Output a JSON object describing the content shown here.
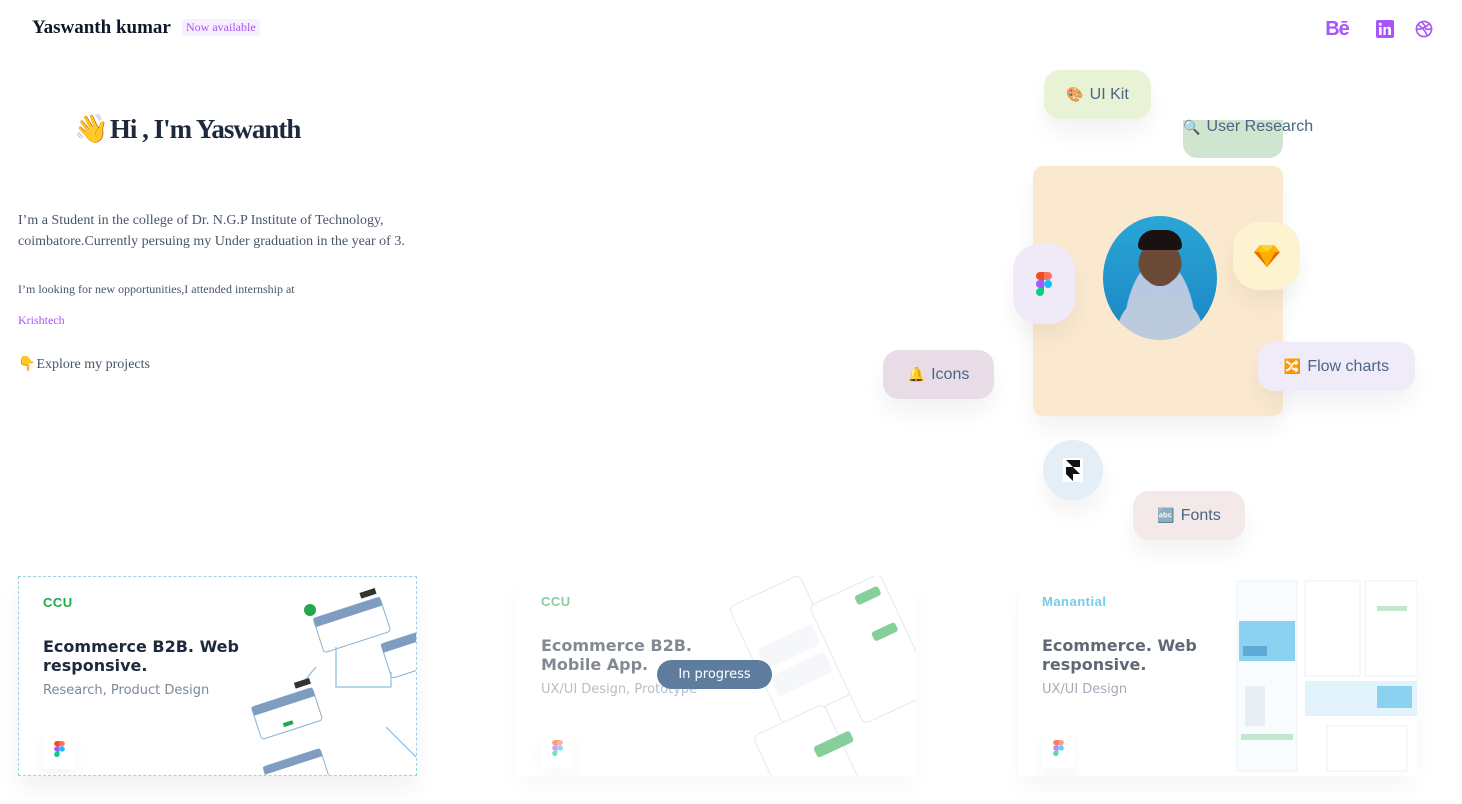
{
  "header": {
    "name": "Yaswanth kumar",
    "status": "Now available",
    "social": [
      {
        "name": "behance",
        "label": "Bē"
      },
      {
        "name": "linkedin",
        "icon": "linkedin-icon"
      },
      {
        "name": "dribbble",
        "icon": "dribbble-icon"
      }
    ]
  },
  "hero": {
    "wave_icon": "👋",
    "title": "Hi , I'm Yaswanth",
    "intro": "I’m a Student in the college of Dr. N.G.P Institute of Technology, coimbatore.Currently persuing my Under graduation in the year of 3.",
    "looking": "I’m looking for new opportunities,I attended internship at",
    "company": "Krishtech",
    "explore_icon": "👇",
    "explore": "Explore my projects"
  },
  "skills": {
    "uikit": {
      "icon": "🎨",
      "label": "UI Kit"
    },
    "research": {
      "icon": "🔍",
      "label": "User Research"
    },
    "icons": {
      "icon": "🔔",
      "label": "Icons"
    },
    "flow": {
      "icon": "🔀",
      "label": "Flow charts"
    },
    "fonts": {
      "icon": "🔤",
      "label": "Fonts"
    },
    "sketch_icon": "💎"
  },
  "projects": [
    {
      "brand": "CCU",
      "brand_color": "#22a84a",
      "title": "Ecommerce B2B. Web responsive.",
      "subtitle": "Research, Product Design"
    },
    {
      "brand": "CCU",
      "brand_color": "#22a84a",
      "title": "Ecommerce B2B. Mobile App.",
      "subtitle": "UX/UI Design, Prototype",
      "badge": "In progress"
    },
    {
      "brand": "Manantial",
      "brand_color": "#38b6e8",
      "title": "Ecommerce. Web responsive.",
      "subtitle": "UX/UI Design"
    }
  ],
  "colors": {
    "accent": "#a855f7",
    "text": "#1e293b",
    "muted": "#475569"
  }
}
